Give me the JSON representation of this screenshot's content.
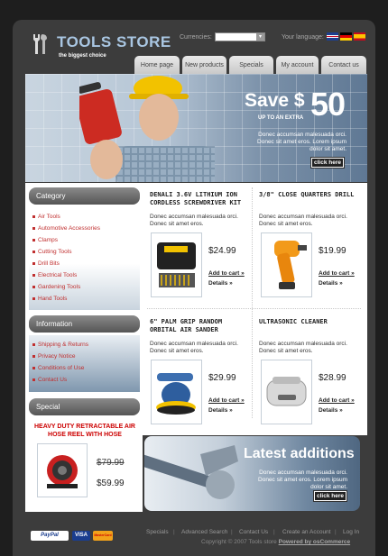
{
  "header": {
    "logo_title": "TOOLS STORE",
    "logo_subtitle": "the biggest choice",
    "currencies_label": "Currencies:",
    "language_label": "Your language:"
  },
  "nav": {
    "items": [
      {
        "label": "Home page"
      },
      {
        "label": "New products"
      },
      {
        "label": "Specials"
      },
      {
        "label": "My account"
      },
      {
        "label": "Contact us"
      }
    ]
  },
  "banner": {
    "save": "Save $",
    "amount": "50",
    "up_to": "UP TO AN EXTRA",
    "text": "Donec accumsan malesuada orci. Donec sit amet eros. Lorem ipsum dolor sit amet.",
    "button": "click here"
  },
  "sidebar": {
    "category_title": "Category",
    "categories": [
      "Air Tools",
      "Automotive Accessories",
      "Clamps",
      "Cutting Tools",
      "Drill Bits",
      "Electrical Tools",
      "Gardening Tools",
      "Hand Tools"
    ],
    "information_title": "Information",
    "information": [
      "Shipping & Returns",
      "Privacy Notice",
      "Conditions of Use",
      "Contact Us"
    ],
    "special_title": "Special",
    "special": {
      "name": "HEAVY DUTY RETRACTABLE AIR HOSE REEL WITH HOSE",
      "old_price": "$79.99",
      "new_price": "$59.99"
    }
  },
  "products": [
    {
      "title": "DENALI 3.6V LITHIUM ION CORDLESS SCREWDRIVER KIT",
      "desc": "Donec accumsan malesuada orci. Donec sit amet eros.",
      "price": "$24.99",
      "cart": "Add to cart »",
      "details": "Details »"
    },
    {
      "title": "3/8\" CLOSE QUARTERS DRILL",
      "desc": "Donec accumsan malesuada orci. Donec sit amet eros.",
      "price": "$19.99",
      "cart": "Add to cart »",
      "details": "Details »"
    },
    {
      "title": "6\" PALM GRIP RANDOM ORBITAL AIR SANDER",
      "desc": "Donec accumsan malesuada orci. Donec sit amet eros.",
      "price": "$29.99",
      "cart": "Add to cart »",
      "details": "Details »"
    },
    {
      "title": "ULTRASONIC CLEANER",
      "desc": "Donec accumsan malesuada orci. Donec sit amet eros.",
      "price": "$28.99",
      "cart": "Add to cart »",
      "details": "Details »"
    }
  ],
  "latest": {
    "title": "Latest additions",
    "text": "Donec accumsan malesuada orci. Donec sit amet eros. Lorem ipsum dolor sit amet.",
    "button": "click here"
  },
  "footer": {
    "links": [
      "Specials",
      "Advanced Search",
      "Contact Us",
      "Create an Account",
      "Log In"
    ],
    "copyright": "Copyright © 2007 Tools store",
    "powered": "Powered by osCommerce",
    "payments": [
      "PayPal",
      "VISA",
      "MasterCard"
    ]
  },
  "colors": {
    "accent": "#c03030",
    "nav": "#d8d8d8",
    "banner": "#7a90a8"
  }
}
